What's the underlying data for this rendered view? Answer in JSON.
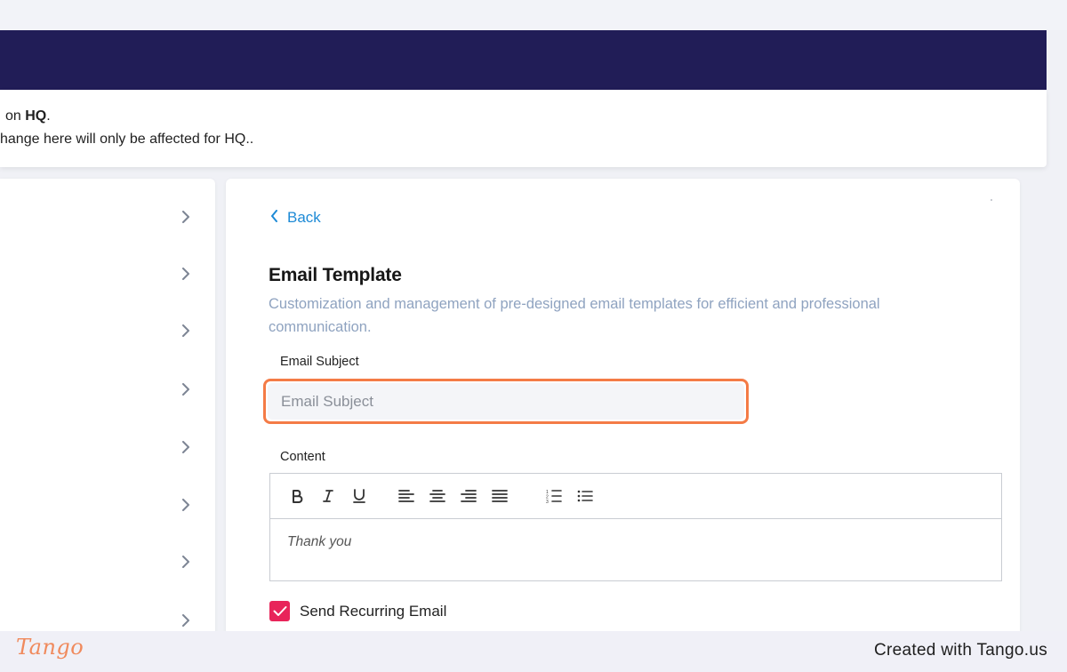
{
  "notice": {
    "prefix": "on ",
    "location": "HQ",
    "suffix": ".",
    "line2": "hange here will only be affected for HQ.."
  },
  "sidebar": {
    "items": [
      {
        "icon": "chevron-right-icon"
      },
      {
        "icon": "chevron-right-icon"
      },
      {
        "icon": "chevron-right-icon"
      },
      {
        "icon": "chevron-right-icon"
      },
      {
        "icon": "chevron-right-icon"
      },
      {
        "icon": "chevron-right-icon"
      },
      {
        "icon": "chevron-right-icon"
      },
      {
        "icon": "chevron-right-icon"
      }
    ]
  },
  "main": {
    "back_label": "Back",
    "title": "Email Template",
    "description": "Customization and management of pre-designed email templates for efficient and professional communication.",
    "subject": {
      "label": "Email Subject",
      "placeholder": "Email Subject",
      "value": ""
    },
    "content": {
      "label": "Content",
      "toolbar": [
        "bold",
        "italic",
        "underline",
        "align-left",
        "align-center",
        "align-right",
        "align-justify",
        "ordered-list",
        "bullet-list"
      ],
      "body": "Thank you"
    },
    "recurring": {
      "label": "Send Recurring Email",
      "checked": true
    }
  },
  "colors": {
    "header": "#211d57",
    "accent_link": "#1d8ad6",
    "highlight": "#f47b46",
    "checkbox": "#e8245a"
  },
  "footer": {
    "logo": "Tango",
    "credit": "Created with Tango.us"
  }
}
